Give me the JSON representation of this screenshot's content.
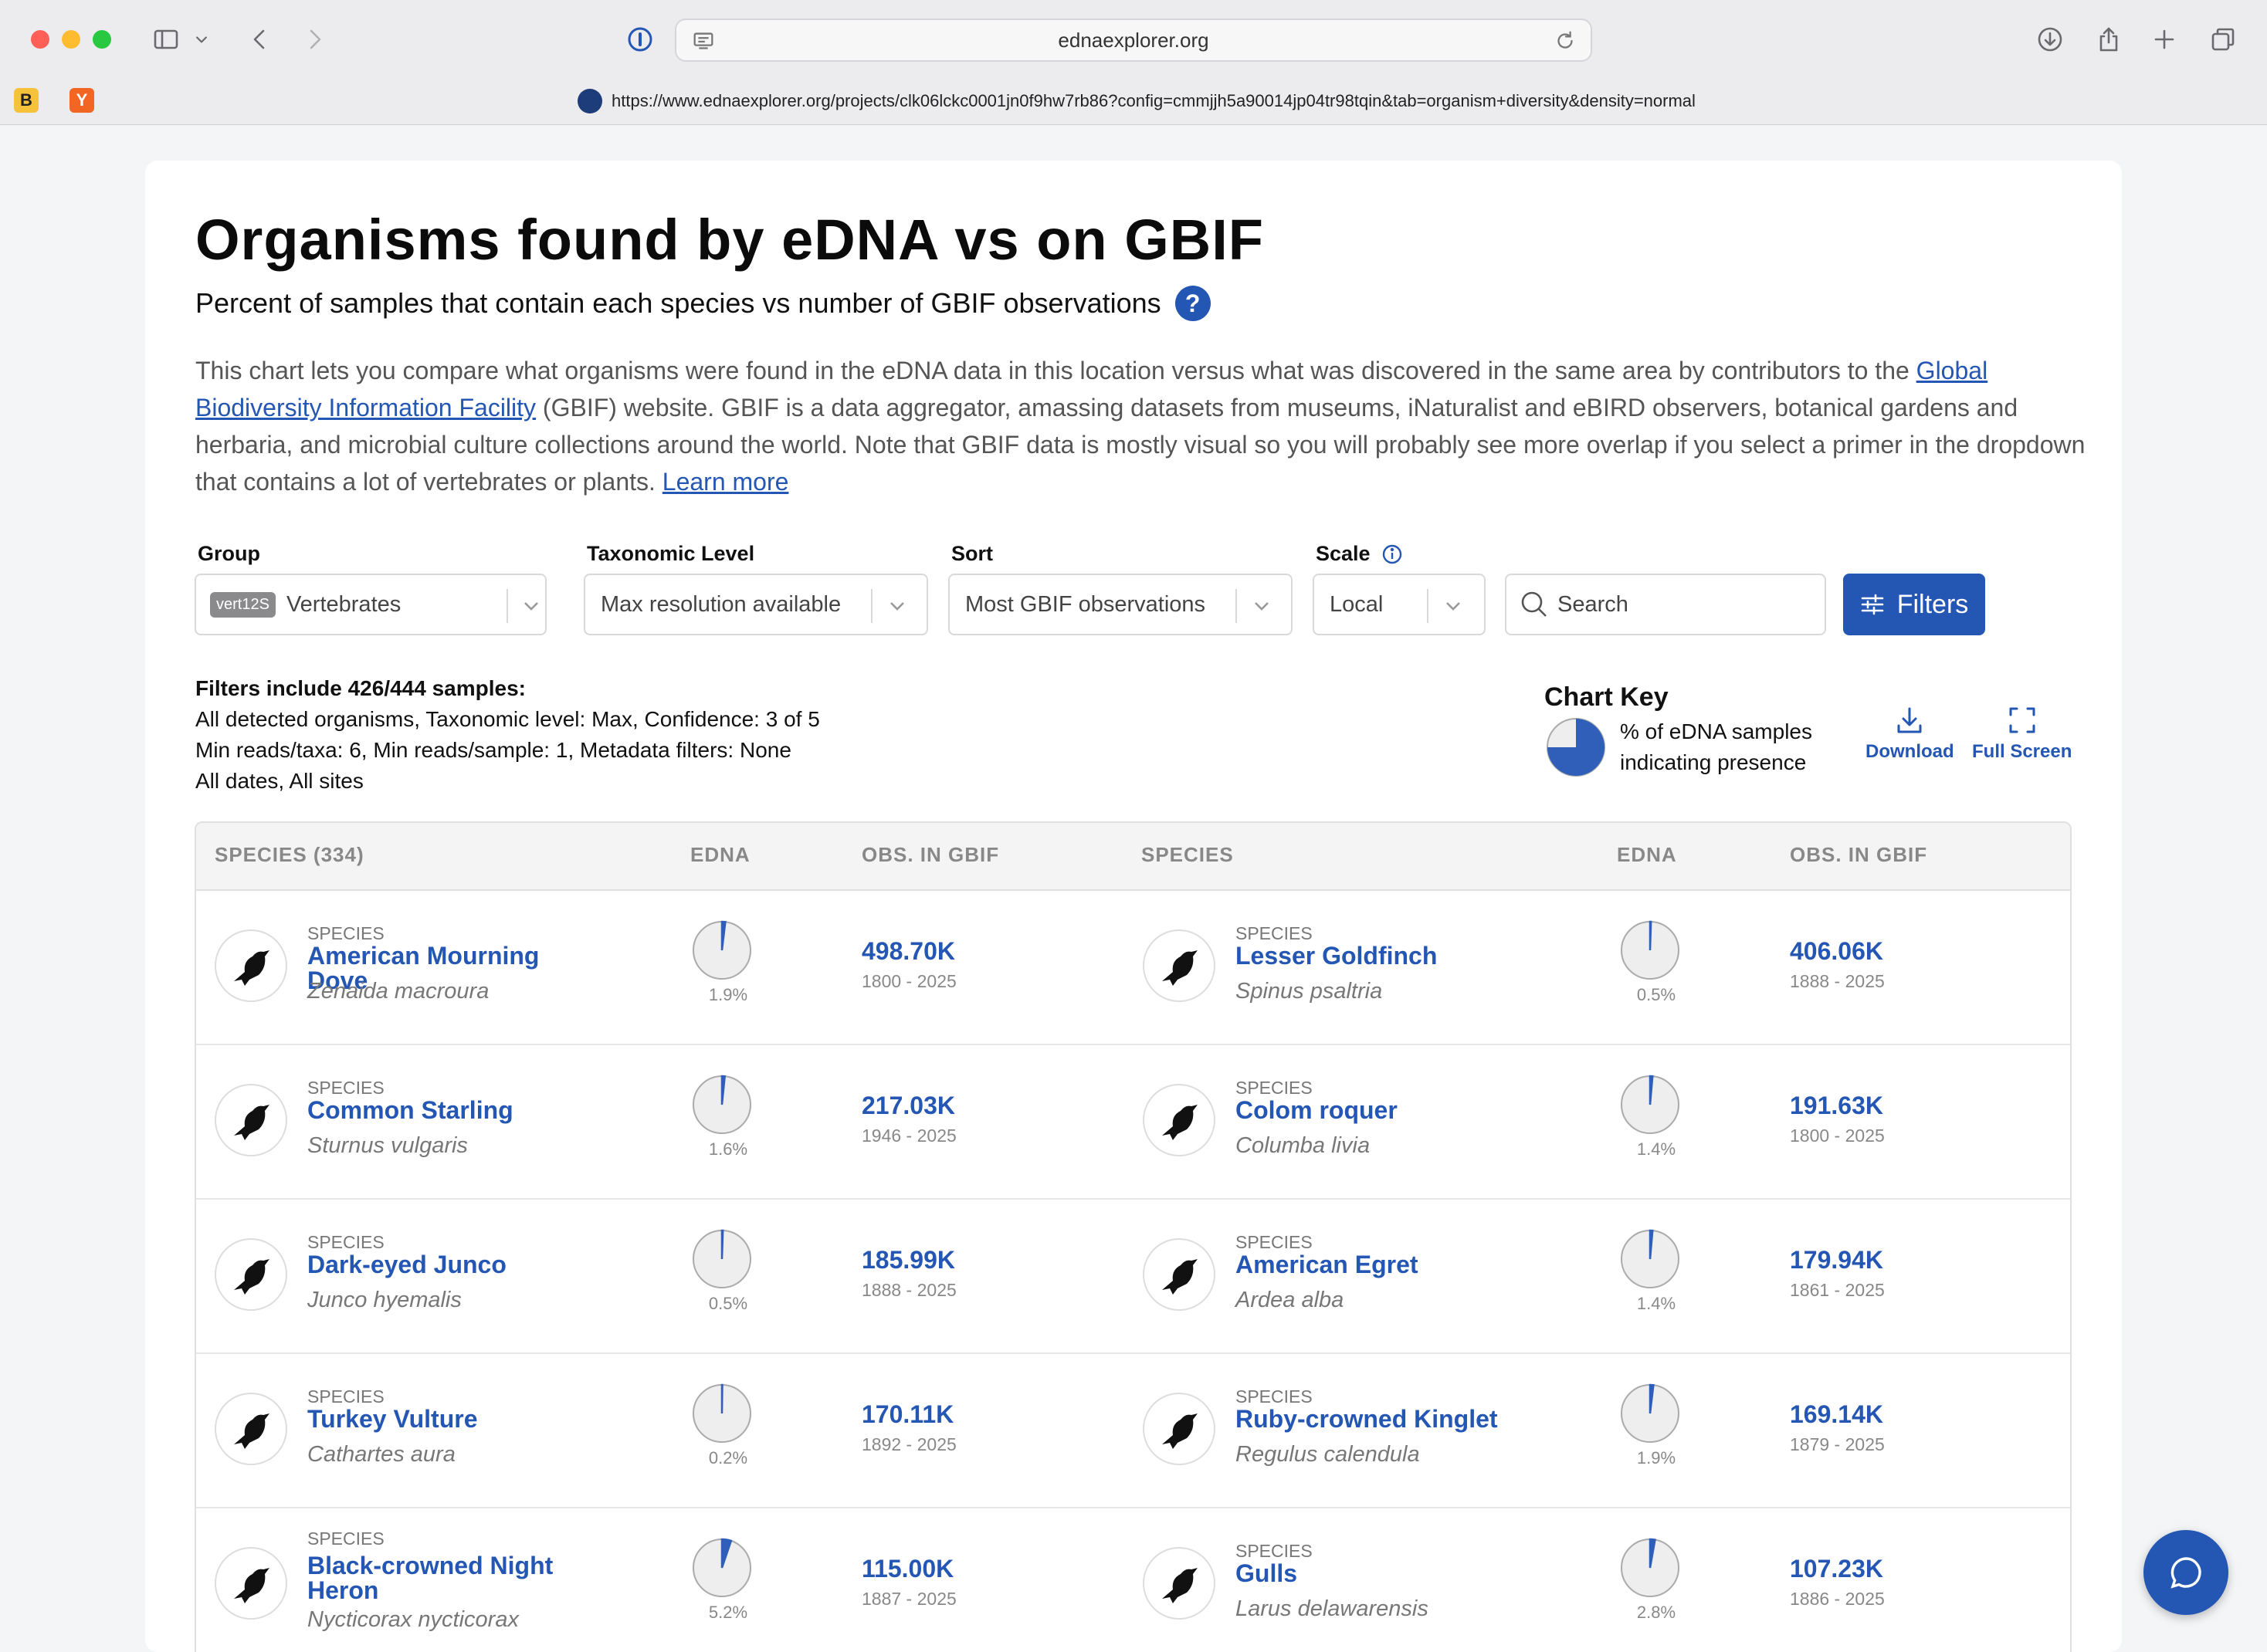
{
  "browser": {
    "address": "ednaexplorer.org",
    "full_url": "https://www.ednaexplorer.org/projects/clk06lckc0001jn0f9hw7rb86?config=cmmjjh5a90014jp04tr98tqin&tab=organism+diversity&density=normal",
    "bookmarks": [
      "B",
      "Y"
    ]
  },
  "page": {
    "title": "Organisms found by eDNA vs on GBIF",
    "subtitle": "Percent of samples that contain each species vs number of GBIF observations",
    "help_label": "?",
    "desc_part1": "This chart lets you compare what organisms were found in the eDNA data in this location versus what was discovered in the same area by contributors to the ",
    "desc_link": "Global Biodiversity Information Facility",
    "desc_part2": " (GBIF) website. GBIF is a data aggregator, amassing datasets from museums, iNaturalist and eBIRD observers, botanical gardens and herbaria, and microbial culture collections around the world. Note that GBIF data is mostly visual so you will probably see more overlap if you select a primer in the dropdown that contains a lot of vertebrates or plants. ",
    "learn_more": "Learn more"
  },
  "filters": {
    "group_label": "Group",
    "group_tag": "vert12S",
    "group_value": "Vertebrates",
    "tax_label": "Taxonomic Level",
    "tax_value": "Max resolution available",
    "sort_label": "Sort",
    "sort_value": "Most GBIF observations",
    "scale_label": "Scale",
    "scale_value": "Local",
    "search_placeholder": "Search",
    "filters_button": "Filters"
  },
  "summary": {
    "heading": "Filters include 426/444 samples:",
    "line1": "All detected organisms, Taxonomic level: Max, Confidence: 3 of 5",
    "line2": "Min reads/taxa: 6, Min reads/sample: 1, Metadata filters: None",
    "line3": "All dates, All sites"
  },
  "chart_key": {
    "title": "Chart Key",
    "line1": "% of eDNA samples",
    "line2": "indicating presence",
    "download": "Download",
    "fullscreen": "Full Screen"
  },
  "table": {
    "headers": {
      "species": "SPECIES (334)",
      "edna": "EDNA",
      "obs": "OBS. IN GBIF",
      "species2": "SPECIES",
      "edna2": "EDNA",
      "obs2": "OBS. IN GBIF"
    },
    "category_label": "SPECIES",
    "rows": [
      [
        {
          "name": "American Mourning Dove",
          "sci": "Zenaida macroura",
          "edna_pct": 1.9,
          "edna_label": "1.9%",
          "obs": "498.70K",
          "years": "1800 - 2025",
          "icon": "dove-icon"
        },
        {
          "name": "Lesser Goldfinch",
          "sci": "Spinus psaltria",
          "edna_pct": 0.5,
          "edna_label": "0.5%",
          "obs": "406.06K",
          "years": "1888 - 2025",
          "icon": "goldfinch-icon"
        }
      ],
      [
        {
          "name": "Common Starling",
          "sci": "Sturnus vulgaris",
          "edna_pct": 1.6,
          "edna_label": "1.6%",
          "obs": "217.03K",
          "years": "1946 - 2025",
          "icon": "starling-icon"
        },
        {
          "name": "Colom roquer",
          "sci": "Columba livia",
          "edna_pct": 1.4,
          "edna_label": "1.4%",
          "obs": "191.63K",
          "years": "1800 - 2025",
          "icon": "pigeon-icon"
        }
      ],
      [
        {
          "name": "Dark-eyed Junco",
          "sci": "Junco hyemalis",
          "edna_pct": 0.5,
          "edna_label": "0.5%",
          "obs": "185.99K",
          "years": "1888 - 2025",
          "icon": "junco-icon"
        },
        {
          "name": "American Egret",
          "sci": "Ardea alba",
          "edna_pct": 1.4,
          "edna_label": "1.4%",
          "obs": "179.94K",
          "years": "1861 - 2025",
          "icon": "egret-icon"
        }
      ],
      [
        {
          "name": "Turkey Vulture",
          "sci": "Cathartes aura",
          "edna_pct": 0.2,
          "edna_label": "0.2%",
          "obs": "170.11K",
          "years": "1892 - 2025",
          "icon": "vulture-icon"
        },
        {
          "name": "Ruby-crowned Kinglet",
          "sci": "Regulus calendula",
          "edna_pct": 1.9,
          "edna_label": "1.9%",
          "obs": "169.14K",
          "years": "1879 - 2025",
          "icon": "kinglet-icon"
        }
      ],
      [
        {
          "name": "Black-crowned Night Heron",
          "sci": "Nycticorax nycticorax",
          "edna_pct": 5.2,
          "edna_label": "5.2%",
          "obs": "115.00K",
          "years": "1887 - 2025",
          "icon": "heron-icon"
        },
        {
          "name": "Gulls",
          "sci": "Larus delawarensis",
          "edna_pct": 2.8,
          "edna_label": "2.8%",
          "obs": "107.23K",
          "years": "1886 - 2025",
          "icon": "gull-icon"
        }
      ]
    ]
  },
  "colors": {
    "accent": "#2456b3",
    "pie_fill": "#2f5fb8",
    "pie_bg": "#eeeeee"
  }
}
